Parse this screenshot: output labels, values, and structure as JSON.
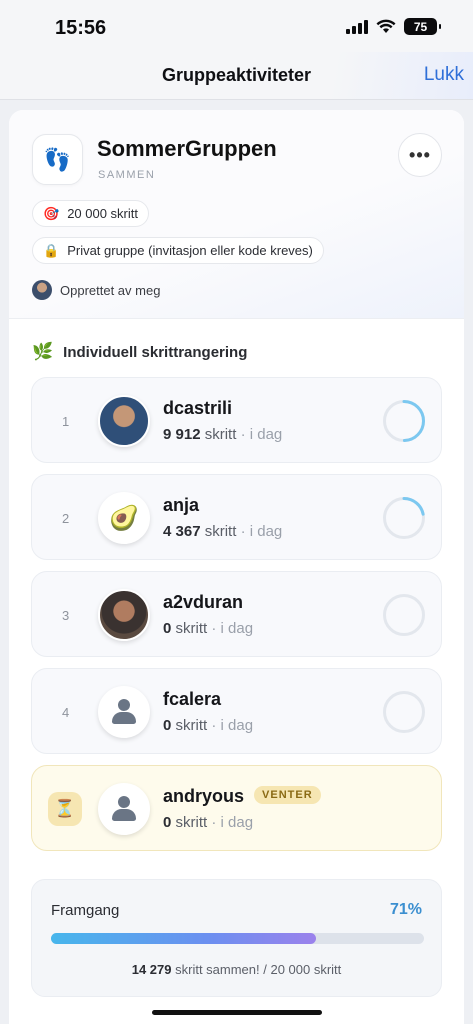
{
  "status_bar": {
    "time": "15:56",
    "battery": "75"
  },
  "nav": {
    "title": "Gruppeaktiviteter",
    "close_label": "Lukk"
  },
  "group": {
    "name": "SommerGruppen",
    "mode": "SAMMEN",
    "goal_chip": "20 000 skritt",
    "privacy_chip": "Privat gruppe (invitasjon eller kode kreves)",
    "creator": "Opprettet av meg",
    "more_label": "•••"
  },
  "ranking": {
    "title": "Individuell skrittrangering",
    "members": [
      {
        "rank": "1",
        "name": "dcastrili",
        "steps": "9 912",
        "steps_unit": "skritt",
        "when": "· i dag",
        "avatar": "photo",
        "ring_progress": 0.4956
      },
      {
        "rank": "2",
        "name": "anja",
        "steps": "4 367",
        "steps_unit": "skritt",
        "when": "· i dag",
        "avatar": "avocado-emoji",
        "ring_progress": 0.2184
      },
      {
        "rank": "3",
        "name": "a2vduran",
        "steps": "0",
        "steps_unit": "skritt",
        "when": "· i dag",
        "avatar": "photo",
        "ring_progress": 0
      },
      {
        "rank": "4",
        "name": "fcalera",
        "steps": "0",
        "steps_unit": "skritt",
        "when": "· i dag",
        "avatar": "person-icon",
        "ring_progress": 0
      }
    ],
    "pending_member": {
      "name": "andryous",
      "badge": "VENTER",
      "steps": "0",
      "steps_unit": "skritt",
      "when": "· i dag"
    }
  },
  "progress": {
    "label": "Framgang",
    "percent_text": "71%",
    "fraction": 0.71,
    "total": "14 279",
    "summary_suffix": "skritt sammen! / 20 000 skritt"
  },
  "colors": {
    "accent": "#2f6fd8",
    "ring": "#7cc8f0",
    "pending_bg": "#fefbec"
  }
}
